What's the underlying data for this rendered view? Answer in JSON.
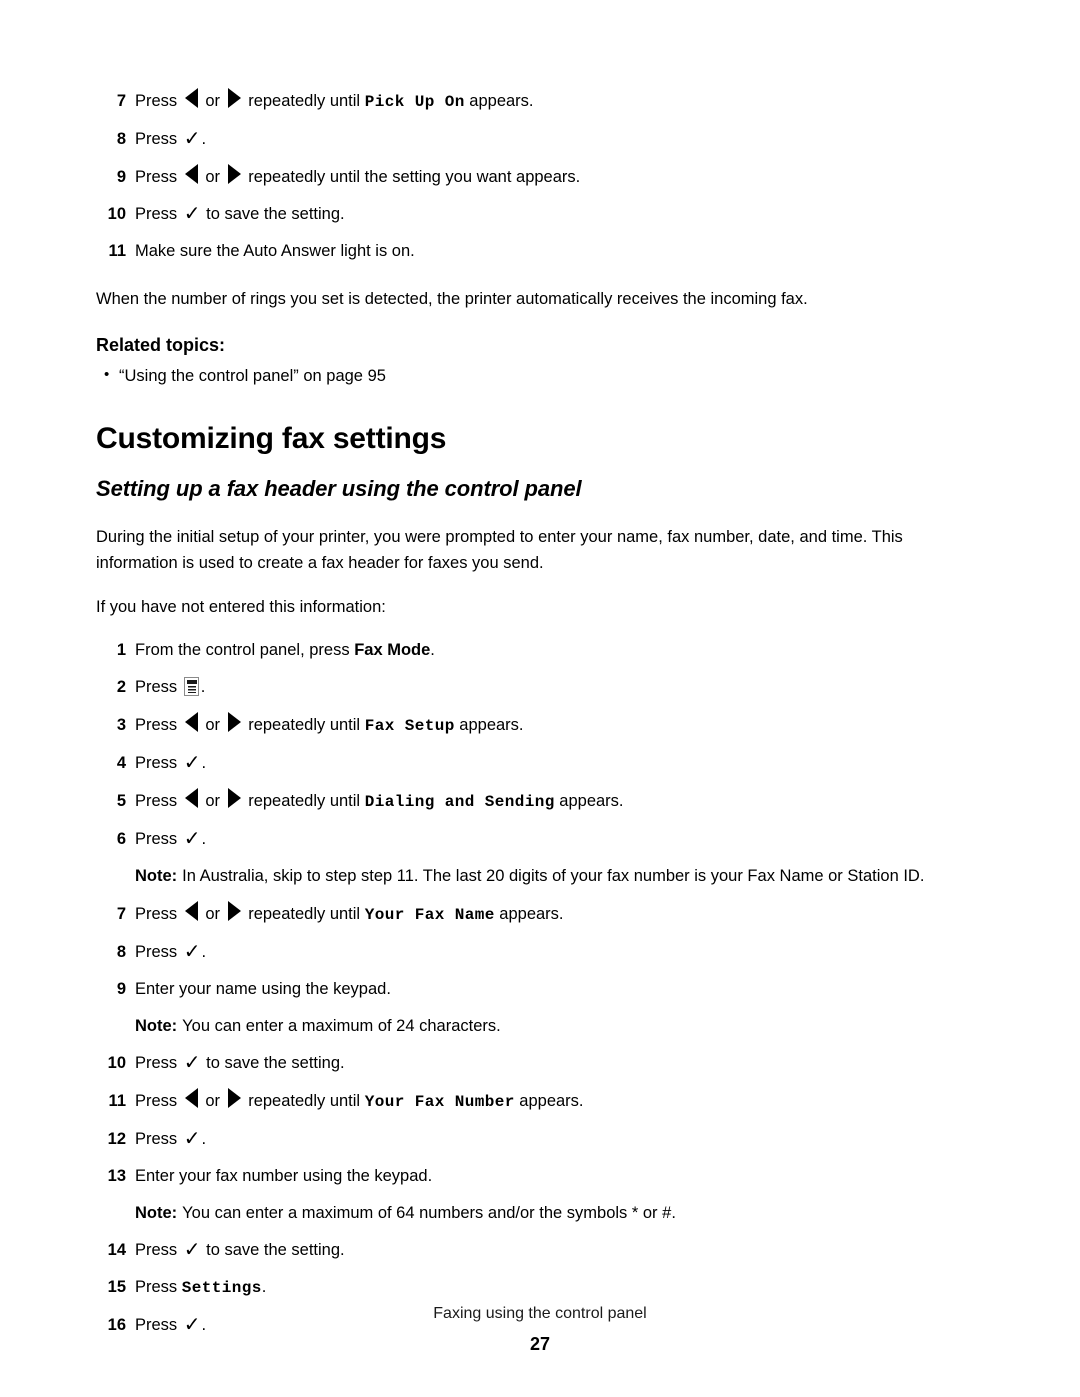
{
  "document": {
    "footer_title": "Faxing using the control panel",
    "page_number": "27"
  },
  "top_steps": [
    {
      "num": "7",
      "pre": "Press ",
      "arrows": true,
      "mid": " repeatedly until ",
      "ui": "Pick Up On",
      "post": " appears."
    },
    {
      "num": "8",
      "pre": "Press ",
      "check": true,
      "post": "."
    },
    {
      "num": "9",
      "pre": "Press ",
      "arrows": true,
      "mid": " repeatedly until the setting you want appears."
    },
    {
      "num": "10",
      "pre": "Press ",
      "check": true,
      "post": " to save the setting."
    },
    {
      "num": "11",
      "pre": "Make sure the Auto Answer light is on."
    }
  ],
  "intro_paragraph": "When the number of rings you set is detected, the printer automatically receives the incoming fax.",
  "related": {
    "heading": "Related topics:",
    "links": [
      "“Using the control panel” on page 95"
    ]
  },
  "section": {
    "h1": "Customizing fax settings",
    "h2": "Setting up a fax header using the control panel",
    "paragraph_1": "During the initial setup of your printer, you were prompted to enter your name, fax number, date, and time. This information is used to create a fax header for faxes you send.",
    "paragraph_2": "If you have not entered this information:"
  },
  "procedure_steps": [
    {
      "num": "1",
      "pre": "From the control panel, press ",
      "boldtext": "Fax Mode",
      "post": "."
    },
    {
      "num": "2",
      "pre": "Press ",
      "menuicon": true,
      "post": "."
    },
    {
      "num": "3",
      "pre": "Press ",
      "arrows": true,
      "mid": " repeatedly until ",
      "ui": "Fax Setup",
      "post": " appears."
    },
    {
      "num": "4",
      "pre": "Press ",
      "check": true,
      "post": "."
    },
    {
      "num": "5",
      "pre": "Press ",
      "arrows": true,
      "mid": " repeatedly until ",
      "ui": "Dialing and Sending",
      "post": " appears."
    },
    {
      "num": "6",
      "pre": "Press ",
      "check": true,
      "post": "."
    }
  ],
  "note_after_6": {
    "label": "Note:",
    "text": "In Australia, skip to step step 11. The last 20 digits of your fax number is your Fax Name or Station ID."
  },
  "procedure_steps_b": [
    {
      "num": "7",
      "pre": "Press ",
      "arrows": true,
      "mid": " repeatedly until ",
      "ui": "Your Fax Name",
      "post": " appears."
    },
    {
      "num": "8",
      "pre": "Press ",
      "check": true,
      "post": "."
    },
    {
      "num": "9",
      "pre": "Enter your name using the keypad."
    }
  ],
  "note_after_9": {
    "label": "Note:",
    "text": "You can enter a maximum of 24 characters."
  },
  "procedure_steps_c": [
    {
      "num": "10",
      "pre": "Press ",
      "check": true,
      "post": " to save the setting."
    },
    {
      "num": "11",
      "pre": "Press ",
      "arrows": true,
      "mid": " repeatedly until ",
      "ui": "Your Fax Number",
      "post": " appears."
    },
    {
      "num": "12",
      "pre": "Press ",
      "check": true,
      "post": "."
    },
    {
      "num": "13",
      "pre": "Enter your fax number using the keypad."
    }
  ],
  "note_after_13": {
    "label": "Note:",
    "text": "You can enter a maximum of 64 numbers and/or the symbols * or #."
  },
  "procedure_steps_d": [
    {
      "num": "14",
      "pre": "Press ",
      "check": true,
      "post": " to save the setting."
    },
    {
      "num": "15",
      "pre": "Press ",
      "ui": "Settings",
      "post": "."
    },
    {
      "num": "16",
      "pre": "Press ",
      "check": true,
      "post": "."
    }
  ],
  "glyphs": {
    "left_arrow": "left-arrow-icon",
    "right_arrow": "right-arrow-icon",
    "check": "✓",
    "or_text": "or",
    "menu_icon": "menu-icon"
  }
}
